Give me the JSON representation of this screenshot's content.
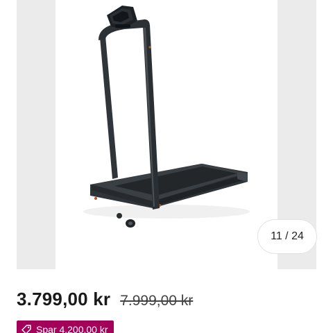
{
  "gallery": {
    "counter_text": "11 / 24"
  },
  "price": {
    "current": "3.799,00 kr",
    "original": "7.999,00 kr"
  },
  "badge": {
    "icon": "tag-icon",
    "text": "Spar 4.200,00 kr",
    "color": "#a3005a"
  }
}
